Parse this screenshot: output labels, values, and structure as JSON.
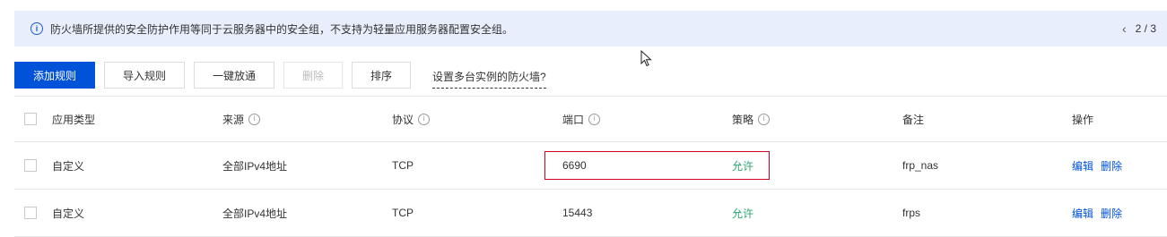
{
  "notice": {
    "text": "防火墙所提供的安全防护作用等同于云服务器中的安全组，不支持为轻量应用服务器配置安全组。",
    "page_indicator": "2 / 3"
  },
  "toolbar": {
    "add_rule": "添加规则",
    "import_rules": "导入规则",
    "one_click_allow": "一键放通",
    "delete": "删除",
    "sort": "排序",
    "multi_instance_link": "设置多台实例的防火墙?"
  },
  "table": {
    "headers": {
      "app_type": "应用类型",
      "source": "来源",
      "protocol": "协议",
      "port": "端口",
      "policy": "策略",
      "remark": "备注",
      "action": "操作"
    },
    "rows": [
      {
        "app_type": "自定义",
        "source": "全部IPv4地址",
        "protocol": "TCP",
        "port": "6690",
        "policy": "允许",
        "remark": "frp_nas",
        "edit": "编辑",
        "delete": "删除"
      },
      {
        "app_type": "自定义",
        "source": "全部IPv4地址",
        "protocol": "TCP",
        "port": "15443",
        "policy": "允许",
        "remark": "frps",
        "edit": "编辑",
        "delete": "删除"
      }
    ]
  },
  "colors": {
    "primary": "#0052d9",
    "allow": "#2ba471",
    "highlight": "#d0021b",
    "notice_bg": "#e8eefc"
  }
}
